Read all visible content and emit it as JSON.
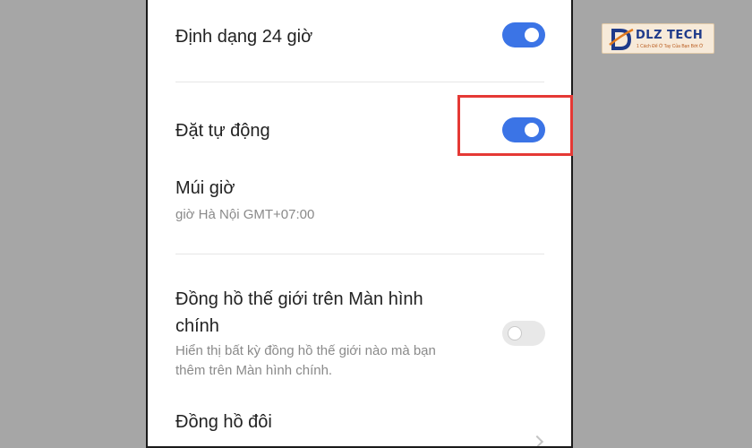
{
  "settings": {
    "format24": {
      "label": "Định dạng 24 giờ",
      "enabled": true
    },
    "autoSet": {
      "label": "Đặt tự động",
      "enabled": true
    },
    "timezone": {
      "label": "Múi giờ",
      "value": "giờ Hà Nội GMT+07:00"
    },
    "worldClock": {
      "label_line1": "Đồng hồ thế giới trên Màn hình",
      "label_line2": "chính",
      "description_line1": "Hiển thị bất kỳ đồng hồ thế giới nào mà bạn",
      "description_line2": "thêm trên Màn hình chính.",
      "enabled": false
    },
    "dualClock": {
      "label": "Đồng hồ đôi"
    }
  },
  "logo": {
    "name": "DLZ TECH",
    "tagline": "1 Cách Để Ở Tay Của Bạn Bớt Ở"
  },
  "colors": {
    "accent": "#3b74e6",
    "highlight": "#e53935"
  }
}
